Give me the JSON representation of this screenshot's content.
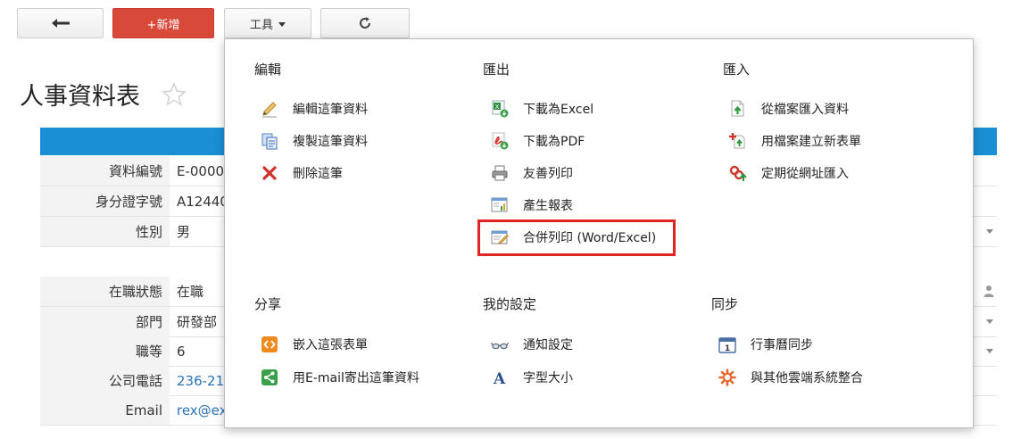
{
  "toolbar": {
    "new_label": "+新增",
    "tools_label": "工具"
  },
  "page": {
    "title": "人事資料表"
  },
  "form": {
    "rows": [
      {
        "label": "資料編號",
        "value": "E-0000"
      },
      {
        "label": "身分證字號",
        "value": "A12440"
      },
      {
        "label": "性別",
        "value": "男"
      },
      {
        "label": "在職狀態",
        "value": "在職"
      },
      {
        "label": "部門",
        "value": "研發部"
      },
      {
        "label": "職等",
        "value": "6"
      },
      {
        "label": "公司電話",
        "value": "236-21"
      },
      {
        "label": "Email",
        "value": "rex@ex"
      }
    ]
  },
  "menu": {
    "edit": {
      "title": "編輯",
      "items": [
        "編輯這筆資料",
        "複製這筆資料",
        "刪除這筆"
      ]
    },
    "export": {
      "title": "匯出",
      "items": [
        "下載為Excel",
        "下載為PDF",
        "友善列印",
        "產生報表",
        "合併列印 (Word/Excel)"
      ]
    },
    "import": {
      "title": "匯入",
      "items": [
        "從檔案匯入資料",
        "用檔案建立新表單",
        "定期從網址匯入"
      ]
    },
    "share": {
      "title": "分享",
      "items": [
        "嵌入這張表單",
        "用E-mail寄出這筆資料"
      ]
    },
    "settings": {
      "title": "我的設定",
      "items": [
        "通知設定",
        "字型大小"
      ]
    },
    "sync": {
      "title": "同步",
      "items": [
        "行事曆同步",
        "與其他雲端系統整合"
      ]
    }
  },
  "colors": {
    "new_button": "#d9493a",
    "form_header": "#1a8fd5",
    "highlight_box": "#e02424"
  }
}
